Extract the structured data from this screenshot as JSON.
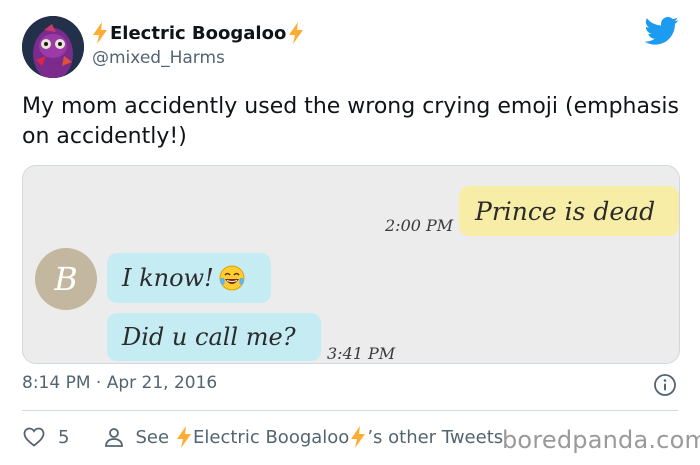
{
  "author": {
    "display_name": "Electric Boogaloo",
    "handle": "@mixed_Harms",
    "name_emoji": "lightning-bolt-icon"
  },
  "tweet": {
    "text": "My mom accidently used the wrong crying emoji (emphasis on accidently!)"
  },
  "media": {
    "messages": [
      {
        "sender": "me",
        "text": "Prince is dead",
        "time": "2:00 PM"
      },
      {
        "sender": "contact",
        "text": "I know!",
        "emoji": "tears-of-joy-emoji-icon"
      },
      {
        "sender": "contact",
        "text": "Did u call me?",
        "time": "3:41 PM"
      }
    ],
    "contact_initial": "B"
  },
  "meta": {
    "timestamp": "8:14 PM · Apr 21, 2016"
  },
  "actions": {
    "like_count": "5",
    "see_prefix": "See",
    "see_name": "Electric Boogaloo",
    "see_suffix": "’s other Tweets"
  },
  "watermark": "boredpanda.com",
  "colors": {
    "twitter_blue": "#1d9bf0",
    "bolt": "#ffac33",
    "my_bubble": "#f7eda6",
    "their_bubble": "#c5ecf3"
  }
}
